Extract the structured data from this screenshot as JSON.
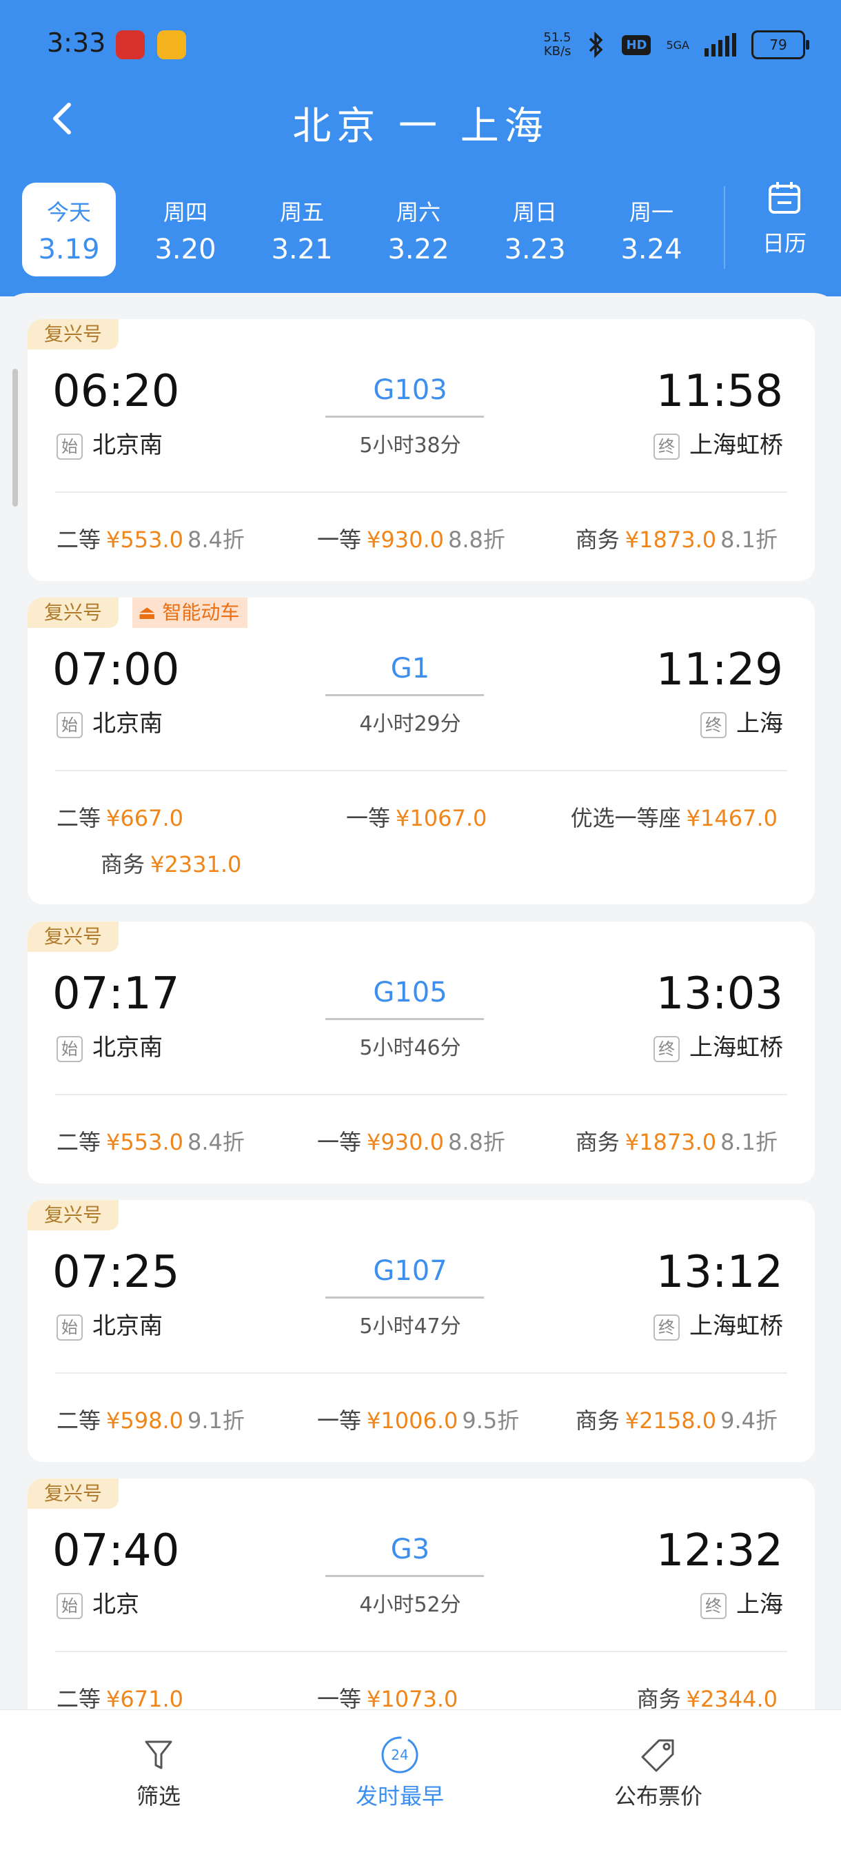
{
  "status": {
    "time": "3:33",
    "net_speed": "51.5",
    "net_unit": "KB/s",
    "hd": "HD",
    "signal": "5GA",
    "battery": "79"
  },
  "header": {
    "title": "北京 一 上海"
  },
  "dates": [
    {
      "weekday": "今天",
      "date": "3.19",
      "selected": true
    },
    {
      "weekday": "周四",
      "date": "3.20"
    },
    {
      "weekday": "周五",
      "date": "3.21"
    },
    {
      "weekday": "周六",
      "date": "3.22"
    },
    {
      "weekday": "周日",
      "date": "3.23"
    },
    {
      "weekday": "周一",
      "date": "3.24"
    }
  ],
  "calendar_label": "日历",
  "start_badge": "始",
  "end_badge": "终",
  "trains": [
    {
      "tag": "复兴号",
      "dep_time": "06:20",
      "arr_time": "11:58",
      "train_no": "G103",
      "duration": "5小时38分",
      "dep_station": "北京南",
      "arr_station": "上海虹桥",
      "prices": [
        {
          "cls": "二等",
          "price": "¥553.0",
          "discount": "8.4折"
        },
        {
          "cls": "一等",
          "price": "¥930.0",
          "discount": "8.8折"
        },
        {
          "cls": "商务",
          "price": "¥1873.0",
          "discount": "8.1折"
        }
      ]
    },
    {
      "tag": "复兴号",
      "tag2": "智能动车",
      "dep_time": "07:00",
      "arr_time": "11:29",
      "train_no": "G1",
      "duration": "4小时29分",
      "dep_station": "北京南",
      "arr_station": "上海",
      "prices": [
        {
          "cls": "二等",
          "price": "¥667.0"
        },
        {
          "cls": "一等",
          "price": "¥1067.0"
        },
        {
          "cls": "优选一等座",
          "price": "¥1467.0"
        },
        {
          "cls": "商务",
          "price": "¥2331.0"
        }
      ]
    },
    {
      "tag": "复兴号",
      "dep_time": "07:17",
      "arr_time": "13:03",
      "train_no": "G105",
      "duration": "5小时46分",
      "dep_station": "北京南",
      "arr_station": "上海虹桥",
      "prices": [
        {
          "cls": "二等",
          "price": "¥553.0",
          "discount": "8.4折"
        },
        {
          "cls": "一等",
          "price": "¥930.0",
          "discount": "8.8折"
        },
        {
          "cls": "商务",
          "price": "¥1873.0",
          "discount": "8.1折"
        }
      ]
    },
    {
      "tag": "复兴号",
      "dep_time": "07:25",
      "arr_time": "13:12",
      "train_no": "G107",
      "duration": "5小时47分",
      "dep_station": "北京南",
      "arr_station": "上海虹桥",
      "prices": [
        {
          "cls": "二等",
          "price": "¥598.0",
          "discount": "9.1折"
        },
        {
          "cls": "一等",
          "price": "¥1006.0",
          "discount": "9.5折"
        },
        {
          "cls": "商务",
          "price": "¥2158.0",
          "discount": "9.4折"
        }
      ]
    },
    {
      "tag": "复兴号",
      "dep_time": "07:40",
      "arr_time": "12:32",
      "train_no": "G3",
      "duration": "4小时52分",
      "dep_station": "北京",
      "arr_station": "上海",
      "prices": [
        {
          "cls": "二等",
          "price": "¥671.0"
        },
        {
          "cls": "一等",
          "price": "¥1073.0"
        },
        {
          "cls": "商务",
          "price": "¥2344.0"
        }
      ]
    }
  ],
  "bottom_tabs": [
    {
      "label": "筛选",
      "icon": "filter-icon"
    },
    {
      "label": "发时最早",
      "icon": "clock-24-icon",
      "badge": "24",
      "active": true
    },
    {
      "label": "公布票价",
      "icon": "price-tag-icon"
    }
  ]
}
